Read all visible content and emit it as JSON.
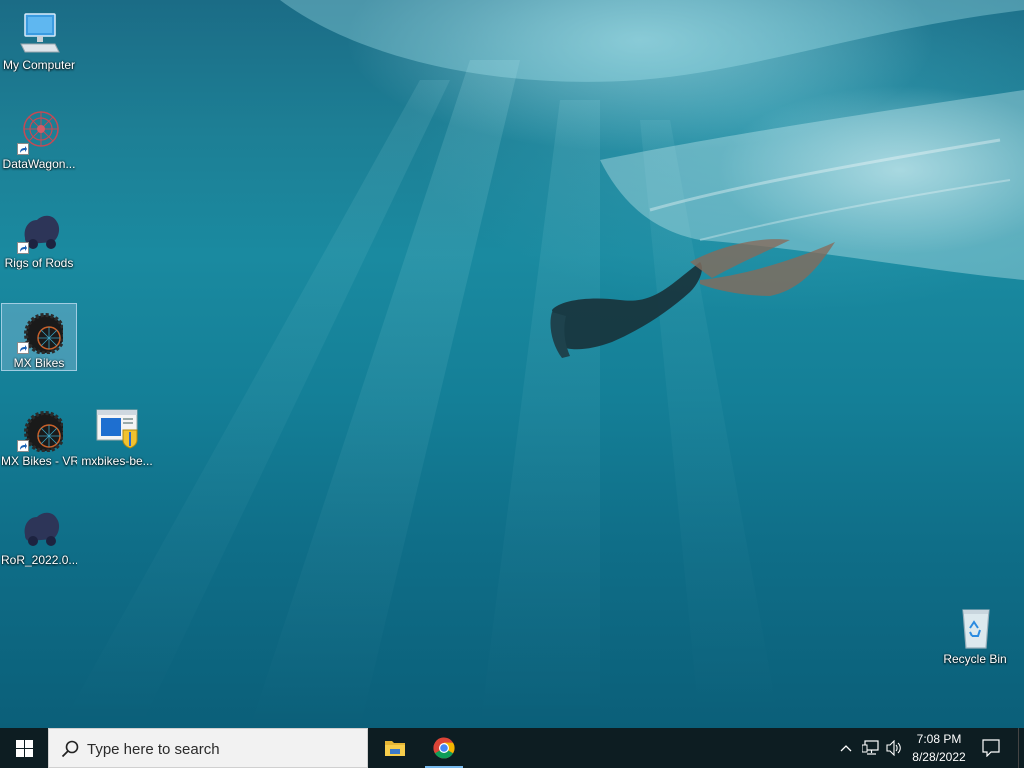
{
  "desktop": {
    "icons": [
      {
        "label": "My Computer",
        "icon": "computer-icon"
      },
      {
        "label": "DataWagon...",
        "icon": "datawagon-icon"
      },
      {
        "label": "Rigs of Rods",
        "icon": "rigs-of-rods-icon"
      },
      {
        "label": "MX Bikes",
        "icon": "mx-bikes-icon",
        "selected": true
      },
      {
        "label": "MX Bikes - VR",
        "icon": "mx-bikes-vr-icon"
      },
      {
        "label": "mxbikes-be...",
        "icon": "installer-icon"
      },
      {
        "label": "RoR_2022.0...",
        "icon": "ror-installer-icon"
      },
      {
        "label": "Recycle Bin",
        "icon": "recycle-bin-icon"
      }
    ]
  },
  "taskbar": {
    "start_icon": "windows-logo-icon",
    "search_placeholder": "Type here to search",
    "pinned": [
      {
        "name": "File Explorer",
        "icon": "folder-icon"
      },
      {
        "name": "Google Chrome",
        "icon": "chrome-icon",
        "active": true
      }
    ],
    "tray": {
      "icons": [
        "chevron-up-icon",
        "network-icon",
        "volume-icon"
      ],
      "time": "7:08 PM",
      "date": "8/28/2022"
    },
    "notifications_icon": "notification-icon"
  },
  "colors": {
    "taskbar_bg": "#0d1d22",
    "accent": "#76b9ed",
    "water": "#1a8aa0"
  }
}
